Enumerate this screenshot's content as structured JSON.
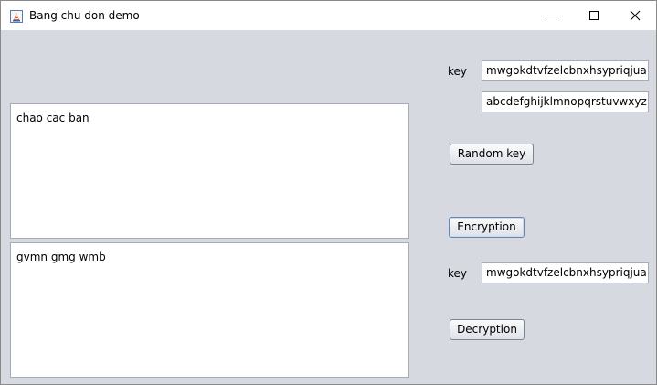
{
  "window": {
    "title": "Bang chu don demo",
    "icons": {
      "app": "java-app-icon",
      "minimize": "minimize-icon",
      "maximize": "maximize-icon",
      "close": "close-icon"
    }
  },
  "plain_text": "chao cac ban",
  "cipher_text": "gvmn gmg wmb",
  "encrypt_section": {
    "key_label": "key",
    "key_value": "mwgokdtvfzelcbnxhsypriqjua",
    "alphabet_value": "abcdefghijklmnopqrstuvwxyz"
  },
  "decrypt_section": {
    "key_label": "key",
    "key_value": "mwgokdtvfzelcbnxhsypriqjua"
  },
  "buttons": {
    "random_key": "Random key",
    "encryption": "Encryption",
    "decryption": "Decryption"
  },
  "colors": {
    "window_bg": "#d6d9df",
    "field_border": "#a5acb5",
    "titlebar_bg": "#ffffff"
  }
}
